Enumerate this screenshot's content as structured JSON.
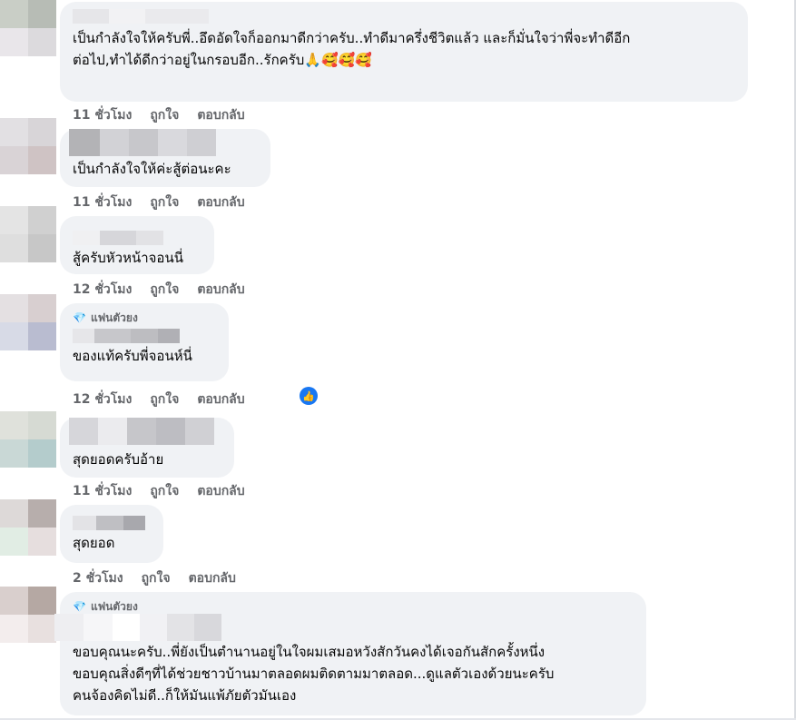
{
  "comments": [
    {
      "text": "เป็นกำลังใจให้ครับพี่..อึดอัดใจก็ออกมาดีกว่าครับ..ทำดีมาครึ่งชีวิตแล้ว และก็มั่นใจว่าพี่จะทำดีอีก\nต่อไป,ทำได้ดีกว่าอยู่ในกรอบอีก..รักครับ🙏🥰🥰🥰",
      "time": "11 ชั่วโมง",
      "like": "ถูกใจ",
      "reply": "ตอบกลับ"
    },
    {
      "text": "เป็นกำลังใจให้ค่ะสู้ต่อนะคะ",
      "time": "11 ชั่วโมง",
      "like": "ถูกใจ",
      "reply": "ตอบกลับ"
    },
    {
      "text": "สู้ครับหัวหน้าจอนนี่",
      "time": "12 ชั่วโมง",
      "like": "ถูกใจ",
      "reply": "ตอบกลับ"
    },
    {
      "badge": "แฟนตัวยง",
      "text": "ของแท้ครับพี่จอนห์นี่",
      "time": "12 ชั่วโมง",
      "like": "ถูกใจ",
      "reply": "ตอบกลับ"
    },
    {
      "text": "สุดยอดครับอ้าย",
      "time": "11 ชั่วโมง",
      "like": "ถูกใจ",
      "reply": "ตอบกลับ"
    },
    {
      "text": "สุดยอด",
      "time": "2 ชั่วโมง",
      "like": "ถูกใจ",
      "reply": "ตอบกลับ"
    },
    {
      "badge": "แฟนตัวยง",
      "text": "ขอบคุณนะครับ..พี่ยังเป็นตำนานอยู่ในใจผมเสมอหวังสักวันคงได้เจอกันสักครั้งหนึ่ง\nขอบคุณสิ่งดีๆที่ได้ช่วยชาวบ้านมาตลอดผมติดตามมาตลอด...ดูแลตัวเองด้วยนะครับ\nคนจ้องคิดไม่ดี..ก็ให้มันแพ้ภัยตัวมันเอง"
    }
  ],
  "colors": {
    "bubble": "#f0f2f5",
    "meta": "#65676b",
    "like_icon": "#1877f2"
  },
  "icons": {
    "badge": "diamond-icon",
    "reaction": "thumbs-up-icon"
  }
}
